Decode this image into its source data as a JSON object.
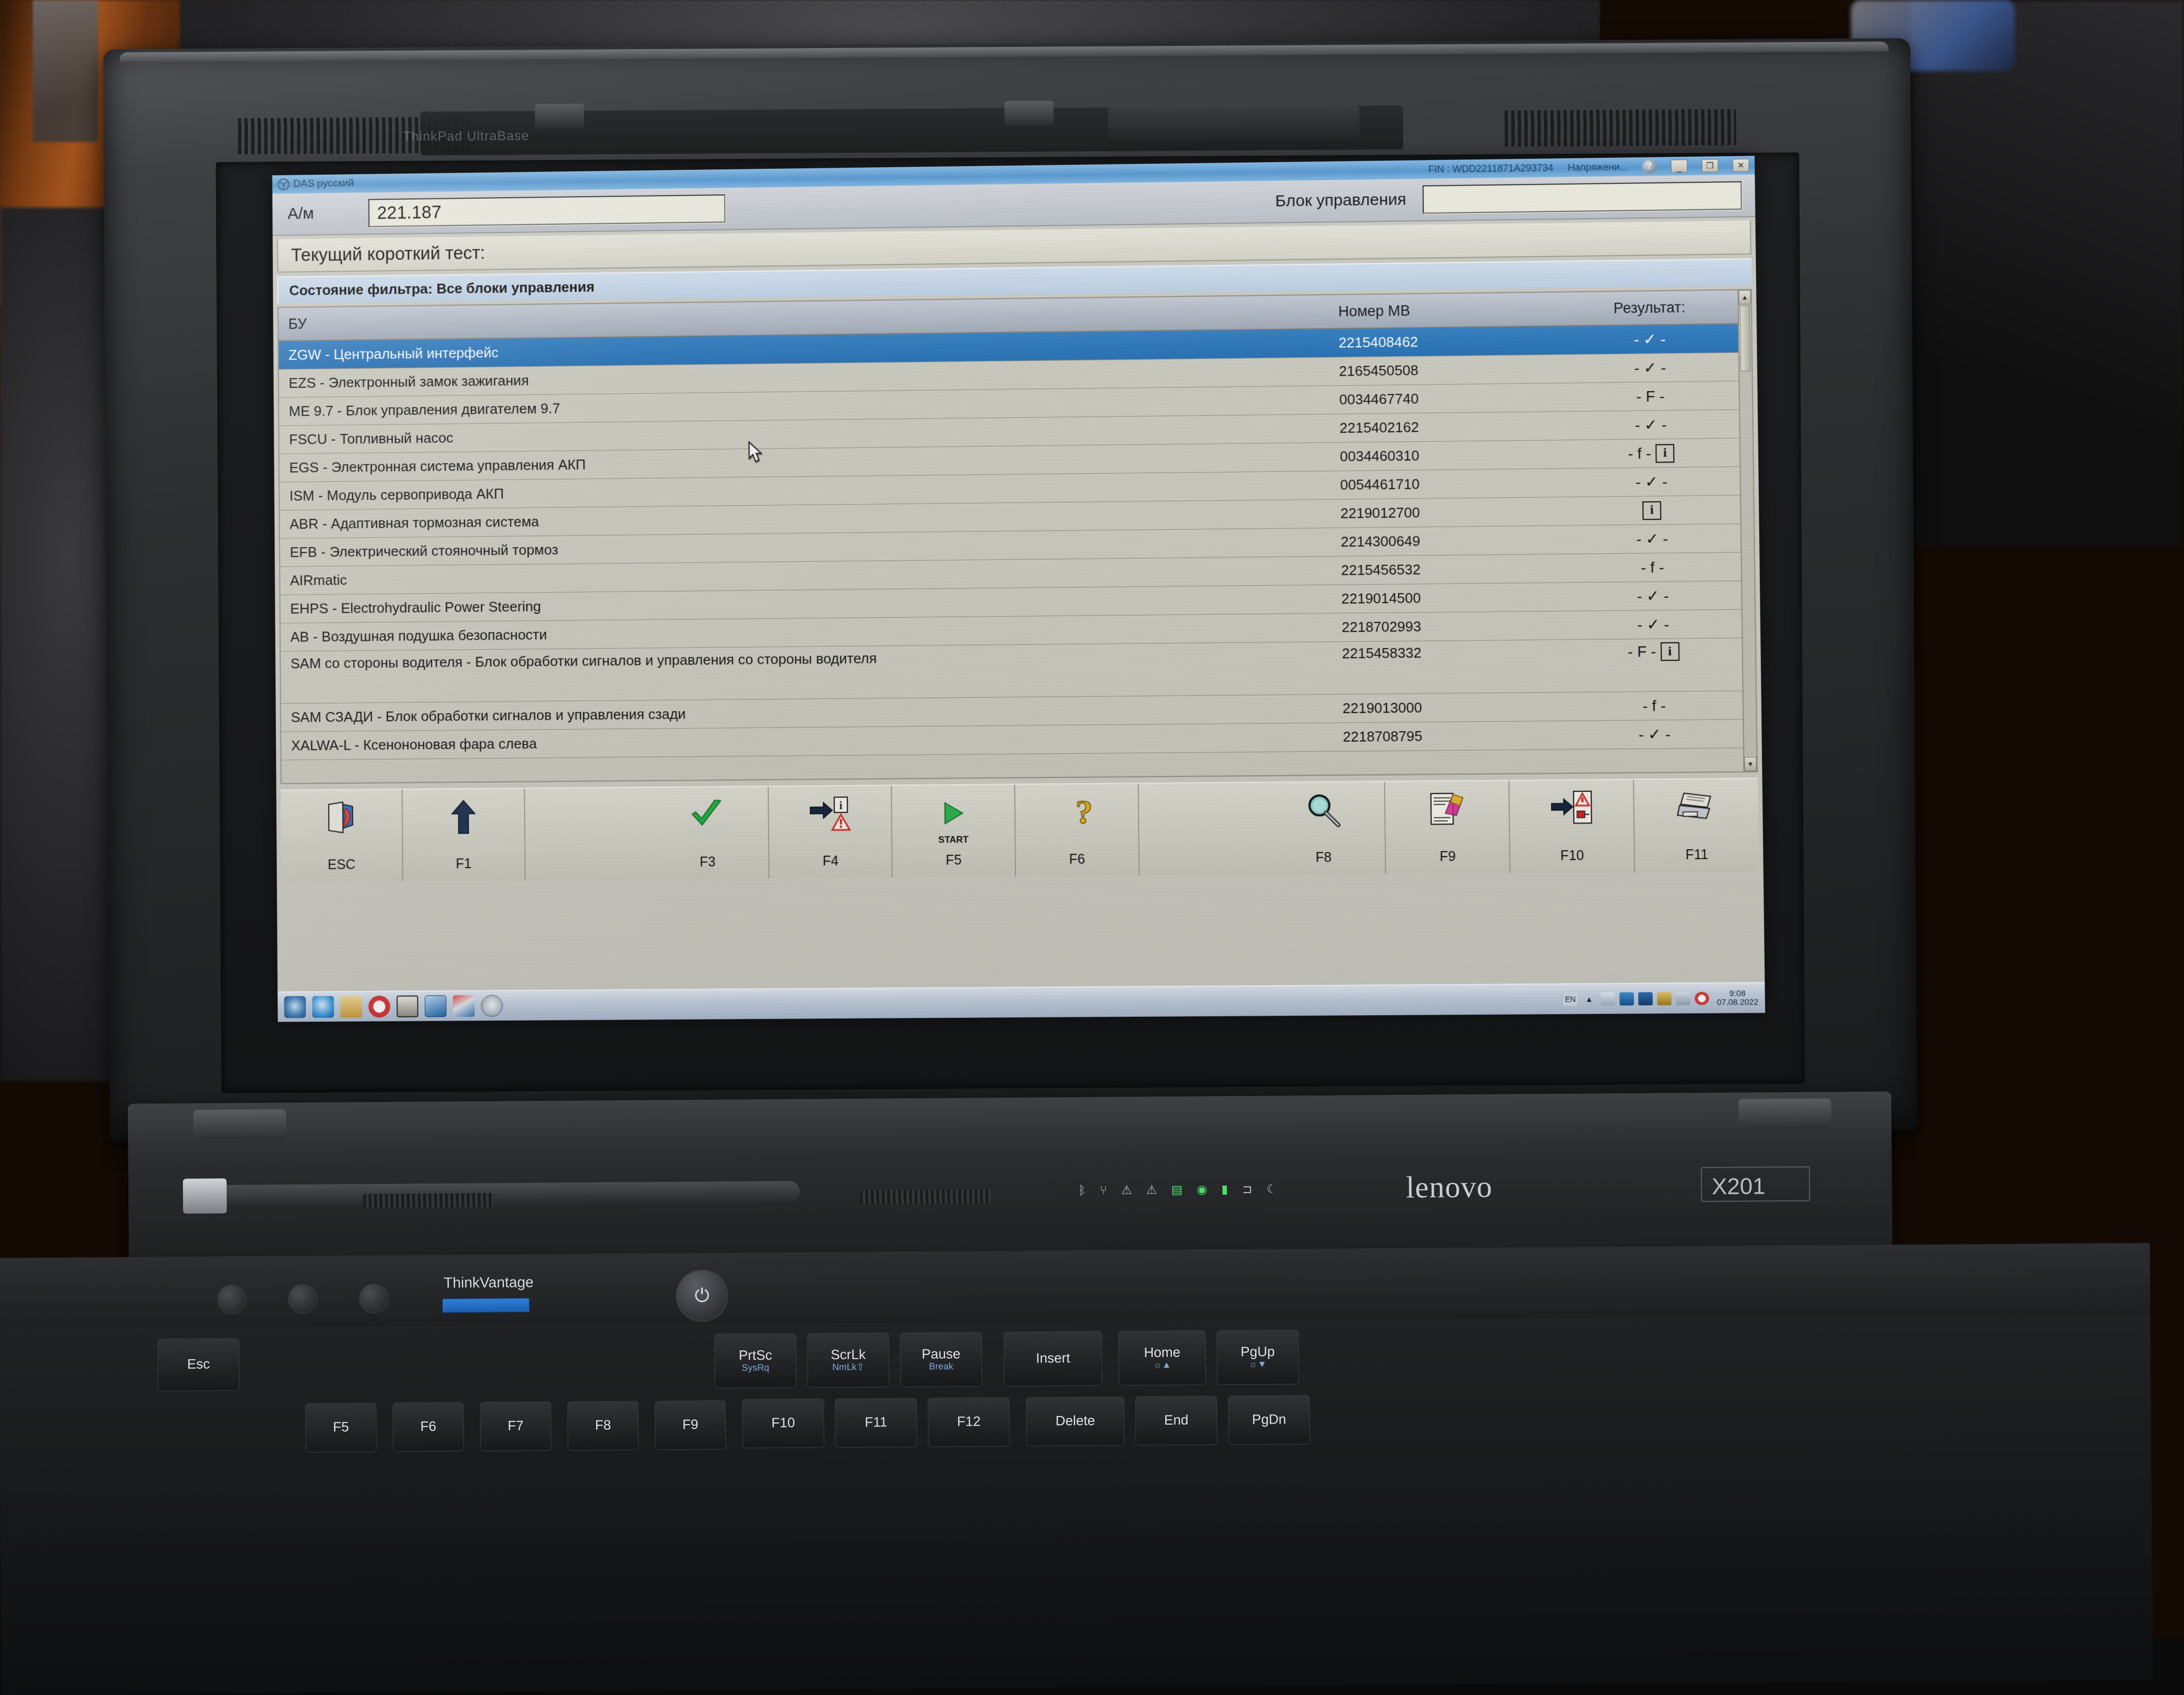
{
  "window": {
    "app_title": "DAS русский",
    "fin_label": "FIN : WDD2211871A293734",
    "voltage_label": "Напряжени...",
    "help_glyph": "?",
    "minimize_glyph": "_",
    "restore_glyph": "❐",
    "close_glyph": "✕"
  },
  "form": {
    "am_label": "А/м",
    "am_value": "221.187",
    "ecu_label": "Блок управления",
    "ecu_value": ""
  },
  "headings": {
    "current_test": "Текущий короткий тест:",
    "filter_state": "Состояние фильтра: Все блоки управления"
  },
  "table": {
    "columns": [
      "БУ",
      "Номер МВ",
      "Результат:"
    ],
    "rows": [
      {
        "name": "ZGW - Центральный интерфейс",
        "mb": "2215408462",
        "result": "- ✓ -",
        "info": false,
        "selected": true
      },
      {
        "name": "EZS - Электронный замок зажигания",
        "mb": "2165450508",
        "result": "- ✓ -",
        "info": false,
        "selected": false
      },
      {
        "name": "ME 9.7 - Блок управления двигателем 9.7",
        "mb": "0034467740",
        "result": "- F -",
        "info": false,
        "selected": false
      },
      {
        "name": "FSCU - Топливный насос",
        "mb": "2215402162",
        "result": "- ✓ -",
        "info": false,
        "selected": false
      },
      {
        "name": "EGS - Электронная система управления АКП",
        "mb": "0034460310",
        "result": "- f -",
        "info": true,
        "selected": false
      },
      {
        "name": "ISM - Модуль сервопривода АКП",
        "mb": "0054461710",
        "result": "- ✓ -",
        "info": false,
        "selected": false
      },
      {
        "name": "ABR - Адаптивная тормозная система",
        "mb": "2219012700",
        "result": "",
        "info": true,
        "selected": false
      },
      {
        "name": "EFB - Электрический стояночный тормоз",
        "mb": "2214300649",
        "result": "- ✓ -",
        "info": false,
        "selected": false
      },
      {
        "name": "AIRmatic",
        "mb": "2215456532",
        "result": "- f -",
        "info": false,
        "selected": false
      },
      {
        "name": "EHPS - Electrohydraulic Power Steering",
        "mb": "2219014500",
        "result": "- ✓ -",
        "info": false,
        "selected": false
      },
      {
        "name": "AB - Воздушная подушка безопасности",
        "mb": "2218702993",
        "result": "- ✓ -",
        "info": false,
        "selected": false
      },
      {
        "name": "SAM со стороны водителя - Блок обработки сигналов и управления со стороны водителя",
        "mb": "2215458332",
        "result": "- F -",
        "info": true,
        "selected": false
      },
      {
        "name": "SAM СЗАДИ - Блок обработки сигналов и управления сзади",
        "mb": "2219013000",
        "result": "- f -",
        "info": false,
        "selected": false
      },
      {
        "name": "XALWA-L - Ксенононовая фара слева",
        "mb": "2218708795",
        "result": "- ✓ -",
        "info": false,
        "selected": false
      }
    ]
  },
  "function_bar": [
    {
      "key": "ESC",
      "icon": "exit-door-icon",
      "sub": ""
    },
    {
      "key": "F1",
      "icon": "up-arrow-icon",
      "sub": ""
    },
    {
      "key": "",
      "icon": "",
      "sub": ""
    },
    {
      "key": "F3",
      "icon": "green-check-icon",
      "sub": ""
    },
    {
      "key": "F4",
      "icon": "goto-fault-icon",
      "sub": ""
    },
    {
      "key": "F5",
      "icon": "start-play-icon",
      "sub": "START"
    },
    {
      "key": "F6",
      "icon": "question-mark-icon",
      "sub": ""
    },
    {
      "key": "",
      "icon": "",
      "sub": ""
    },
    {
      "key": "F8",
      "icon": "magnifier-icon",
      "sub": ""
    },
    {
      "key": "F9",
      "icon": "document-color-icon",
      "sub": ""
    },
    {
      "key": "F10",
      "icon": "fault-transfer-icon",
      "sub": ""
    },
    {
      "key": "F11",
      "icon": "printer-icon",
      "sub": ""
    }
  ],
  "taskbar": {
    "items": [
      "mercedes-star-icon",
      "internet-explorer-icon",
      "folder-icon",
      "no-entry-icon",
      "monitor-icon",
      "network-icon",
      "tools-icon",
      "mercedes-das-icon"
    ],
    "tray": [
      "language-en-icon",
      "volume-icon",
      "network-tray-icon",
      "shield-icon",
      "disk-icon",
      "media-icon",
      "no-entry-tray-icon"
    ],
    "clock_time": "9:08",
    "clock_date": "07.08.2022"
  },
  "laptop": {
    "brand": "lenovo",
    "model": "X201",
    "ultrabase_label": "ThinkPad UltraBase",
    "thinkvantage_label": "ThinkVantage",
    "power_glyph": "⏻",
    "keys": {
      "esc": "Esc",
      "prtsc": "PrtSc",
      "sysrq": "SysRq",
      "scrlk": "ScrLk",
      "nmlk": "NmLk⇧",
      "pause": "Pause",
      "break": "Break",
      "insert": "Insert",
      "home": "Home",
      "home_sub": "☼▲",
      "pgup": "PgUp",
      "pgup_sub": "☼▼",
      "delete": "Delete",
      "end": "End",
      "pgdn": "PgDn",
      "f5": "F5",
      "f6": "F6",
      "f7": "F7",
      "f8": "F8",
      "f9": "F9",
      "f10": "F10",
      "f11": "F11",
      "f12": "F12"
    }
  }
}
